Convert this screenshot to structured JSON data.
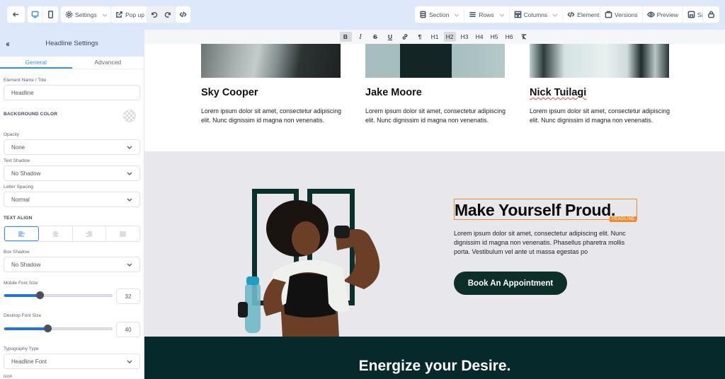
{
  "toolbar": {
    "left": {
      "back_icon": "arrow-left-icon",
      "devices": [
        "desktop-icon",
        "mobile-icon"
      ],
      "settings_label": "Settings",
      "popup_label": "Pop up",
      "undo_icon": "undo-icon",
      "redo_icon": "redo-icon",
      "code_icon": "code-icon"
    },
    "right": {
      "section_label": "Section",
      "rows_label": "Rows",
      "columns_label": "Columns",
      "elements_label": "Elements",
      "versions_label": "Versions",
      "preview_label": "Preview",
      "save_label": "Save",
      "lock_icon": "lock-icon"
    }
  },
  "format_bar": {
    "buttons": [
      "B",
      "I",
      "S",
      "U",
      "link",
      "¶",
      "H1",
      "H2",
      "H3",
      "H4",
      "H5",
      "H6",
      "clear-format"
    ],
    "active": [
      "B",
      "H2"
    ]
  },
  "panel": {
    "title": "Headline Settings",
    "tabs": [
      {
        "label": "General",
        "active": true
      },
      {
        "label": "Advanced",
        "active": false
      }
    ],
    "element_name_label": "Element Name / Title",
    "element_name_value": "Headline",
    "background_color_label": "BACKGROUND COLOR",
    "opacity_label": "Opacity",
    "opacity_value": "None",
    "text_shadow_label": "Text Shadow",
    "text_shadow_value": "No Shadow",
    "letter_spacing_label": "Letter Spacing",
    "letter_spacing_value": "Normal",
    "text_align_label": "TEXT ALIGN",
    "text_align_options": [
      "left",
      "center",
      "right",
      "justify"
    ],
    "text_align_selected": "left",
    "box_shadow_label": "Box Shadow",
    "box_shadow_value": "No Shadow",
    "mobile_font_size_label": "Mobile Font Size",
    "mobile_font_size_value": "32",
    "mobile_font_size_fraction": 0.33,
    "desktop_font_size_label": "Desktop Font Size",
    "desktop_font_size_value": "40",
    "desktop_font_size_fraction": 0.4,
    "typography_type_label": "Typography Type",
    "typography_type_value": "Headline Font",
    "icon_label": "Icon"
  },
  "team": [
    {
      "name": "Sky Cooper",
      "text": "Lorem ipsum dolor sit amet, consectetur adipiscing elit. Nunc dignissim id magna non venenatis."
    },
    {
      "name": "Jake Moore",
      "text": "Lorem ipsum dolor sit amet, consectetur adipiscing elit. Nunc dignissim id magna non venenatis."
    },
    {
      "name": "Nick Tuilagi",
      "text": "Lorem ipsum dolor sit amet, consectetur adipiscing elit. Nunc dignissim id magna non venenatis."
    }
  ],
  "hero": {
    "headline": "Make Yourself Proud.",
    "badge": "HEADLINE",
    "text": "Lorem ipsum dolor sit amet, consectetur adipiscing elit. Nunc dignissim id magna non venenatis. Phasellus pharetra mollis porta. Vestibulum vel ante ut massa egestas po",
    "cta": "Book An Appointment"
  },
  "band": {
    "title": "Energize your Desire."
  },
  "colors": {
    "accent": "#3b8ef0",
    "selection": "#f28b2d",
    "brand_dark": "#0c2f2c",
    "band": "#062a2c",
    "hero_bg": "#e8e7ec"
  }
}
